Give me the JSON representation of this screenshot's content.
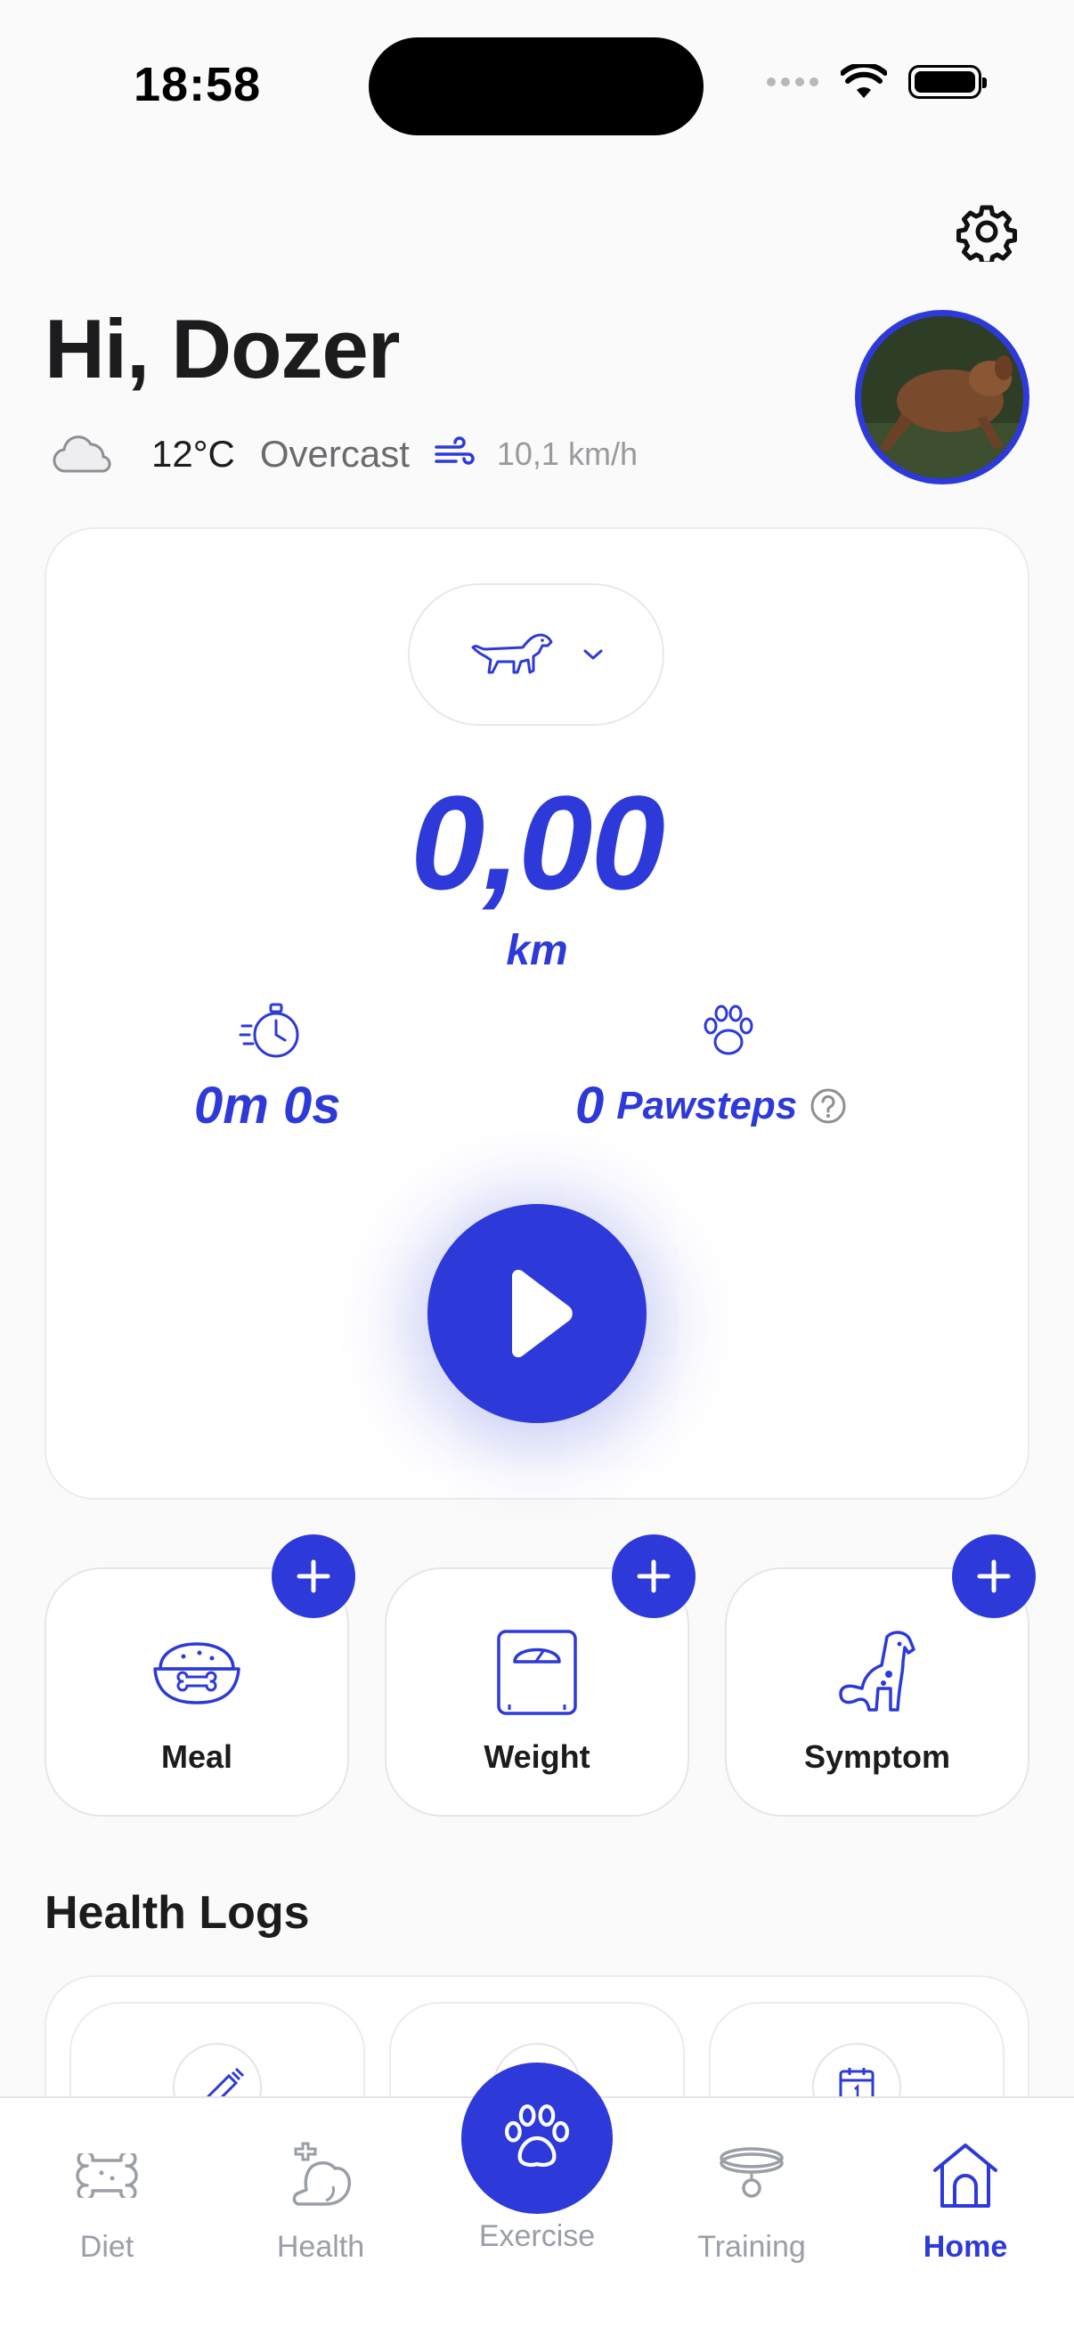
{
  "status_bar": {
    "time": "18:58"
  },
  "header": {
    "greeting": "Hi, Dozer",
    "weather": {
      "temperature": "12°C",
      "condition": "Overcast",
      "wind": "10,1 km/h"
    }
  },
  "tracker": {
    "distance": "0,00",
    "unit": "km",
    "duration": "0m 0s",
    "pawsteps_value": "0",
    "pawsteps_label": "Pawsteps"
  },
  "quick_add": [
    {
      "label": "Meal"
    },
    {
      "label": "Weight"
    },
    {
      "label": "Symptom"
    }
  ],
  "health_logs": {
    "title": "Health Logs"
  },
  "tabbar": {
    "items": [
      {
        "label": "Diet"
      },
      {
        "label": "Health"
      },
      {
        "label": "Exercise"
      },
      {
        "label": "Training"
      },
      {
        "label": "Home"
      }
    ],
    "active": "Home"
  },
  "colors": {
    "accent": "#2d3ad9",
    "inactive": "#9a9ea6",
    "text": "#1c1c1e"
  }
}
